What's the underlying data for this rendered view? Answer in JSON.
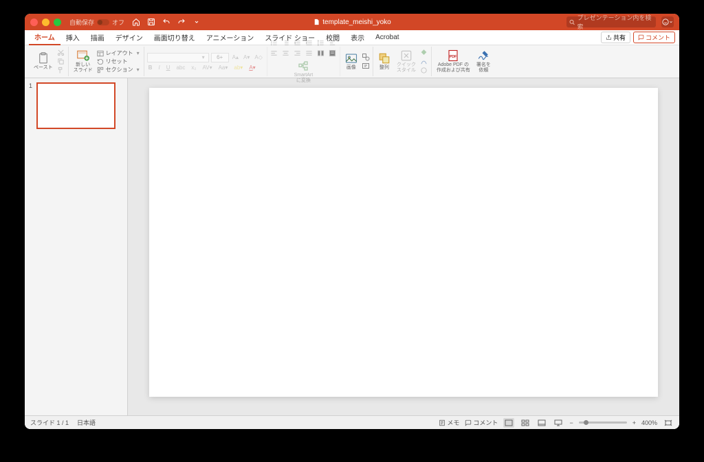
{
  "titlebar": {
    "autosave_label": "自動保存",
    "autosave_state": "オフ",
    "doc_title": "template_meishi_yoko",
    "search_placeholder": "プレゼンテーション内を検索"
  },
  "menu": {
    "items": [
      "ホーム",
      "挿入",
      "描画",
      "デザイン",
      "画面切り替え",
      "アニメーション",
      "スライド ショー",
      "校閲",
      "表示",
      "Acrobat"
    ],
    "share": "共有",
    "comments": "コメント"
  },
  "ribbon": {
    "paste": "ペースト",
    "new_slide": "新しい\nスライド",
    "layout": "レイアウト",
    "reset": "リセット",
    "section": "セクション",
    "font_size": "6+",
    "smartart": "SmartArt\nに変換",
    "picture": "画像",
    "arrange": "整列",
    "quick_styles": "クイック\nスタイル",
    "adobe": "Adobe PDF の\n作成および共有",
    "signature": "署名を\n依頼"
  },
  "thumb": {
    "num": "1"
  },
  "status": {
    "slide_indicator": "スライド 1 / 1",
    "language": "日本語",
    "notes": "メモ",
    "comments": "コメント",
    "zoom": "400%"
  }
}
